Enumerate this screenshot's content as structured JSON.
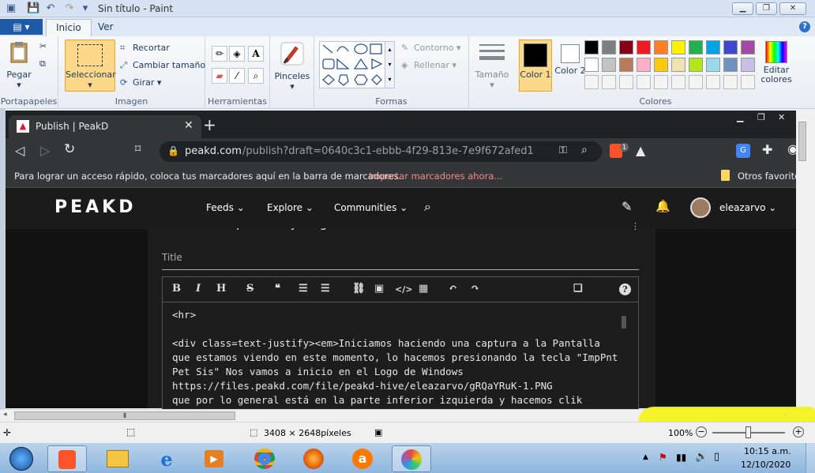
{
  "paint": {
    "window_title": "Sin título - Paint",
    "tabs": [
      "Inicio",
      "Ver"
    ],
    "groups": {
      "clipboard": {
        "label": "Portapapeles",
        "paste": "Pegar"
      },
      "image": {
        "label": "Imagen",
        "select": "Seleccionar",
        "crop": "Recortar",
        "resize": "Cambiar tamaño",
        "rotate": "Girar"
      },
      "tools": {
        "label": "Herramientas"
      },
      "brushes": {
        "label": "Pinceles"
      },
      "shapes": {
        "label": "Formas",
        "outline": "Contorno",
        "fill": "Rellenar"
      },
      "size": {
        "label": "Tamaño"
      },
      "colors": {
        "label": "Colores",
        "color1": "Color 1",
        "color2": "Color 2",
        "edit": "Editar colores"
      }
    },
    "palette": [
      "#000000",
      "#7f7f7f",
      "#880015",
      "#ed1c24",
      "#ff7f27",
      "#fff200",
      "#22b14c",
      "#00a2e8",
      "#3f48cc",
      "#a349a4",
      "#ffffff",
      "#c3c3c3",
      "#b97a57",
      "#ffaec9",
      "#ffc90e",
      "#efe4b0",
      "#b5e61d",
      "#99d9ea",
      "#7092be",
      "#c8bfe7"
    ],
    "status": {
      "dimensions": "3408 × 2648píxeles",
      "zoom": "100%"
    }
  },
  "browser": {
    "tab_title": "Publish | PeakD",
    "url_host": "peakd.com",
    "url_path": "/publish?draft=0640c3c1-ebbb-4f29-813e-7e9f672afed1",
    "brave_badge": "1",
    "bookmarks_text": "Para lograr un acceso rápido, coloca tus marcadores aquí en la barra de marcadores.",
    "bookmarks_link": "Importar marcadores ahora...",
    "other_bookmarks": "Otros favoritos"
  },
  "peakd": {
    "logo": "PEAKD",
    "nav": [
      "Feeds",
      "Explore",
      "Communities"
    ],
    "username": "eleazarvo",
    "header_partial": "Write a new post in My Blog",
    "title_placeholder": "Title",
    "editor_lines": [
      "<hr>",
      "",
      "<div class=text-justify><em>Iniciamos haciendo una captura a la Pantalla",
      "que estamos viendo en este momento, lo hacemos presionando la tecla \"ImpPnt",
      "Pet Sis\" Nos vamos a inicio en el Logo de Windows",
      "https://files.peakd.com/file/peakd-hive/eleazarvo/gRQaYRuK-1.PNG",
      "que por lo general está en la parte inferior izquierda y hacemos clik"
    ]
  },
  "taskbar": {
    "time": "10:15 a.m.",
    "date": "12/10/2020"
  }
}
